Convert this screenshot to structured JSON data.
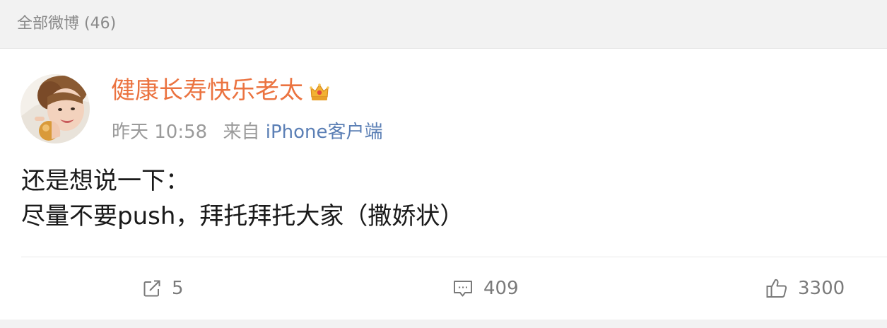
{
  "section": {
    "title": "全部微博 (46)"
  },
  "post": {
    "username": "健康长寿快乐老太",
    "badge_icon": "crown-icon",
    "timestamp": "昨天 10:58",
    "source_prefix": "来自",
    "source_name": "iPhone客户端",
    "content_lines": [
      "还是想说一下：",
      "尽量不要push，拜托拜托大家（撒娇状）"
    ],
    "actions": {
      "repost": {
        "icon": "share-icon",
        "count": "5"
      },
      "comment": {
        "icon": "comment-icon",
        "count": "409"
      },
      "like": {
        "icon": "thumbs-up-icon",
        "count": "3300"
      }
    }
  },
  "colors": {
    "username": "#eb7340",
    "source_link": "#5b7fb5",
    "meta": "#9a9a9a",
    "background": "#f2f2f2"
  }
}
